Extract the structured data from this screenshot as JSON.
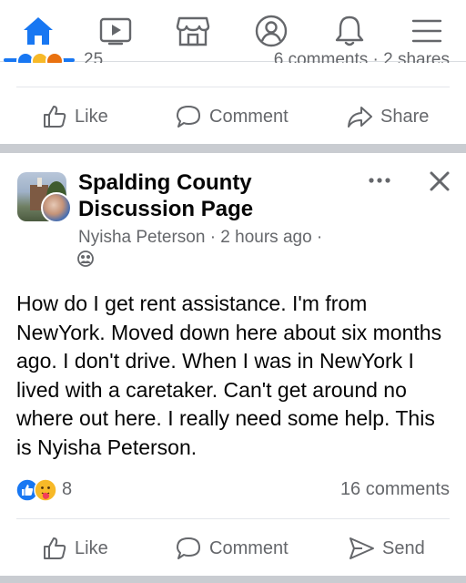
{
  "nav": {
    "items": [
      {
        "icon": "home-icon",
        "active": true
      },
      {
        "icon": "watch-icon",
        "active": false
      },
      {
        "icon": "marketplace-icon",
        "active": false
      },
      {
        "icon": "profile-icon",
        "active": false
      },
      {
        "icon": "notifications-icon",
        "active": false
      },
      {
        "icon": "menu-icon",
        "active": false
      }
    ],
    "accent": "#1877f2",
    "inactive_color": "#65676b"
  },
  "prev_post": {
    "reaction_count": "25",
    "meta": "6 comments · 2 shares",
    "actions": {
      "like": "Like",
      "comment": "Comment",
      "share": "Share"
    }
  },
  "post": {
    "group_name": "Spalding County Discussion Page",
    "author": "Nyisha Peterson",
    "time": "· 2 hours ago ·",
    "privacy_icon": "members-icon",
    "body": "How do I get rent assistance. I'm from NewYork. Moved down here about six months ago. I don't drive. When I was in NewYork I lived with a caretaker. Can't get around no where out here. I really need some help. This is Nyisha Peterson.",
    "reactions": {
      "types": [
        "like-reaction",
        "care-reaction"
      ],
      "count": "8"
    },
    "comments": "16 comments",
    "actions": {
      "like": "Like",
      "comment": "Comment",
      "send": "Send"
    }
  },
  "colors": {
    "like_blue": "#1877f2",
    "secondary_text": "#65676b",
    "separator": "#c9ccd1"
  }
}
